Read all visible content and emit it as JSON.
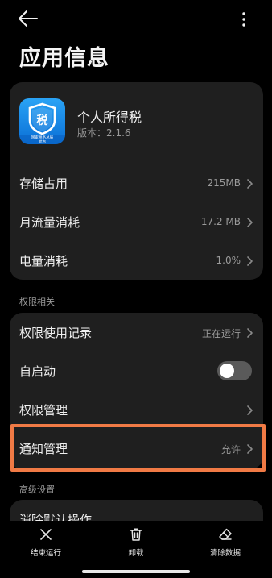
{
  "header": {
    "title": "应用信息"
  },
  "app": {
    "name": "个人所得税",
    "version": "版本：2.1.6",
    "icon_glyph": "税",
    "icon_caption_1": "国家税务总局",
    "icon_caption_2": "发布"
  },
  "info_rows": [
    {
      "label": "存储占用",
      "value": "215MB"
    },
    {
      "label": "月流量消耗",
      "value": "17.2 MB"
    },
    {
      "label": "电量消耗",
      "value": "1.0%"
    }
  ],
  "permissions": {
    "section_title": "权限相关",
    "usage_record": {
      "label": "权限使用记录",
      "value": "正在运行"
    },
    "autostart": {
      "label": "自启动",
      "enabled": false
    },
    "manage": {
      "label": "权限管理"
    },
    "notification": {
      "label": "通知管理",
      "value": "允许"
    }
  },
  "advanced": {
    "section_title": "高级设置",
    "clear_defaults": {
      "label": "消除默认操作"
    }
  },
  "bottom_actions": {
    "stop": "结束运行",
    "uninstall": "卸载",
    "clear_data": "清除数据"
  },
  "colors": {
    "background": "#000000",
    "card": "#1f1f1f",
    "highlight": "#f07a45",
    "icon_blue": "#1a8ff0"
  }
}
